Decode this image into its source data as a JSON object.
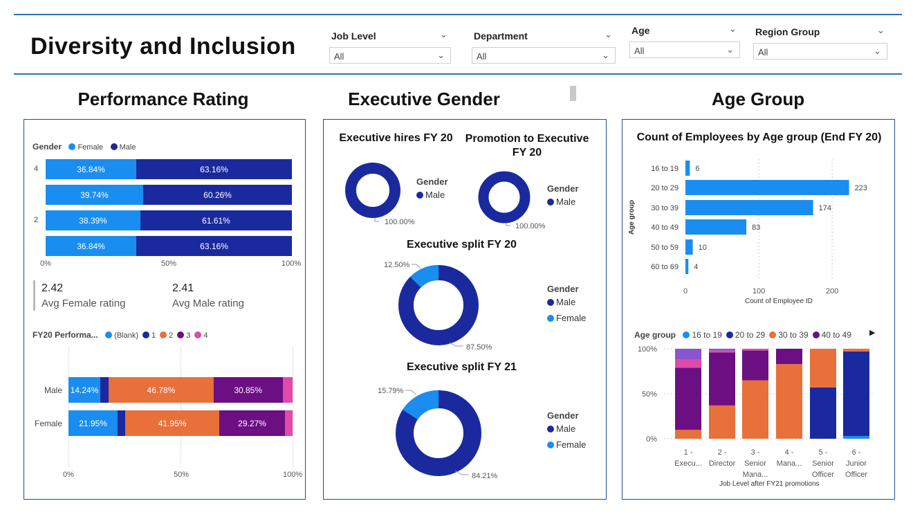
{
  "title": "Diversity and Inclusion",
  "filters": [
    {
      "label": "Job Level",
      "value": "All"
    },
    {
      "label": "Department",
      "value": "All"
    },
    {
      "label": "Age",
      "value": "All"
    },
    {
      "label": "Region Group",
      "value": "All"
    }
  ],
  "sections": {
    "performance": "Performance Rating",
    "executive": "Executive Gender",
    "age": "Age Group"
  },
  "perf_gender": {
    "legend_title": "Gender",
    "legend": [
      "Female",
      "Male"
    ],
    "colors": {
      "female": "#1a8ef0",
      "male": "#1a2a9e"
    },
    "row_labels": [
      "4",
      "",
      "2",
      ""
    ],
    "rows": [
      {
        "female": "36.84%",
        "male": "63.16%",
        "female_frac": 0.3684
      },
      {
        "female": "39.74%",
        "male": "60.26%",
        "female_frac": 0.3974
      },
      {
        "female": "38.39%",
        "male": "61.61%",
        "female_frac": 0.3839
      },
      {
        "female": "36.84%",
        "male": "63.16%",
        "female_frac": 0.3684
      }
    ],
    "ticks": [
      "0%",
      "50%",
      "100%"
    ]
  },
  "kpis": [
    {
      "value": "2.42",
      "label": "Avg Female rating"
    },
    {
      "value": "2.41",
      "label": "Avg Male rating"
    }
  ],
  "fy20_perf": {
    "legend_title": "FY20 Performa...",
    "legend": [
      {
        "name": "(Blank)",
        "color": "#1a8ef0"
      },
      {
        "name": "1",
        "color": "#1a2a9e"
      },
      {
        "name": "2",
        "color": "#e8703a"
      },
      {
        "name": "3",
        "color": "#6b0f82"
      },
      {
        "name": "4",
        "color": "#e04aa8"
      }
    ],
    "rows": [
      {
        "label": "Male",
        "segments": [
          {
            "frac": 0.1424,
            "text": "14.24%"
          },
          {
            "frac": 0.037,
            "text": ""
          },
          {
            "frac": 0.4678,
            "text": "46.78%"
          },
          {
            "frac": 0.3085,
            "text": "30.85%"
          },
          {
            "frac": 0.0443,
            "text": ""
          }
        ]
      },
      {
        "label": "Female",
        "segments": [
          {
            "frac": 0.2195,
            "text": "21.95%"
          },
          {
            "frac": 0.0341,
            "text": ""
          },
          {
            "frac": 0.4195,
            "text": "41.95%"
          },
          {
            "frac": 0.2927,
            "text": "29.27%"
          },
          {
            "frac": 0.0342,
            "text": ""
          }
        ]
      }
    ],
    "ticks": [
      "0%",
      "50%",
      "100%"
    ]
  },
  "executive": {
    "hires_title": "Executive hires FY 20",
    "promo_title": "Promotion to Executive FY 20",
    "split20_title": "Executive split FY 20",
    "split21_title": "Executive split FY 21",
    "legend_title": "Gender",
    "male": "Male",
    "female": "Female",
    "hires_label": "100.00%",
    "promo_label": "100.00%",
    "split20": {
      "female": 0.125,
      "female_label": "12.50%",
      "male_label": "87.50%"
    },
    "split21": {
      "female": 0.1579,
      "female_label": "15.79%",
      "male_label": "84.21%"
    }
  },
  "chart_data": [
    {
      "type": "bar",
      "title": "Count of Employees by Age group (End FY 20)",
      "xlabel": "Count of Employee ID",
      "ylabel": "Age group",
      "categories": [
        "16 to 19",
        "20 to 29",
        "30 to 39",
        "40 to 49",
        "50 to 59",
        "60 to 69"
      ],
      "values": [
        6,
        223,
        174,
        83,
        10,
        4
      ],
      "xticks": [
        "0",
        "100",
        "200"
      ],
      "xlim": [
        0,
        230
      ],
      "color": "#1a8ef0"
    },
    {
      "type": "bar",
      "stacked": "percent",
      "xlabel": "Job Level after FY21 promotions",
      "legend_title": "Age group",
      "legend": [
        {
          "name": "16 to 19",
          "color": "#1a8ef0"
        },
        {
          "name": "20 to 29",
          "color": "#1a2a9e"
        },
        {
          "name": "30 to 39",
          "color": "#e8703a"
        },
        {
          "name": "40 to 49",
          "color": "#6b0f82"
        }
      ],
      "extra_colors": [
        "#e04aa8",
        "#8a55d0"
      ],
      "categories": [
        [
          "1 -",
          "Execu..."
        ],
        [
          "2 -",
          "Director"
        ],
        [
          "3 -",
          "Senior",
          "Mana..."
        ],
        [
          "4 -",
          "Mana..."
        ],
        [
          "5 -",
          "Senior",
          "Officer"
        ],
        [
          "6 -",
          "Junior",
          "Officer"
        ]
      ],
      "stacks": [
        [
          0,
          0,
          0.1,
          0.69,
          0.09,
          0.12
        ],
        [
          0,
          0,
          0.37,
          0.59,
          0.02,
          0.02
        ],
        [
          0,
          0,
          0.65,
          0.33,
          0.02,
          0
        ],
        [
          0,
          0,
          0.83,
          0.17,
          0,
          0
        ],
        [
          0,
          0.57,
          0.43,
          0,
          0,
          0
        ],
        [
          0.03,
          0.94,
          0.03,
          0,
          0,
          0
        ]
      ],
      "yticks": [
        "100%",
        "50%",
        "0%"
      ]
    }
  ]
}
